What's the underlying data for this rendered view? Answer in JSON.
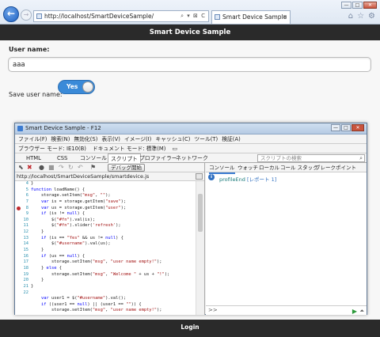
{
  "browser": {
    "url": "http://localhost/SmartDeviceSample/",
    "tab_title": "Smart Device Sample",
    "window_controls": [
      "—",
      "□",
      "✕"
    ],
    "address_tools": "⌕ ▾ ⊠ C"
  },
  "app": {
    "header_title": "Smart Device Sample",
    "username_label": "User name:",
    "username_value": "aaa",
    "save_label": "Save user name:",
    "switch_value": "Yes",
    "footer_button": "Login"
  },
  "devtools": {
    "title": "Smart Device Sample - F12",
    "menu": [
      "ファイル(F)",
      "検索(N)",
      "無効化(S)",
      "表示(V)",
      "イメージ(I)",
      "キャッシュ(C)",
      "ツール(T)",
      "検証(A)"
    ],
    "browser_mode": "ブラウザー モード: IE10(B)",
    "document_mode": "ドキュメント モード: 標準(M)",
    "tabs": [
      "HTML",
      "CSS",
      "コンソール",
      "スクリプト",
      "プロファイラー",
      "ネットワーク"
    ],
    "active_tab": "スクリプト",
    "search_placeholder": "スクリプトの検索",
    "debug_button": "デバッグ開始",
    "file_path": "http://localhost/SmartDeviceSample/smartdevice.js",
    "right_tabs": [
      "コンソール",
      "ウォッチ",
      "ローカル",
      "コール スタック",
      "ブレークポイント"
    ],
    "console_message": "profileEnd",
    "console_report": "[レポート 1]",
    "console_prompt": ">>",
    "code_lines": [
      {
        "n": "4",
        "t": "}"
      },
      {
        "n": "5",
        "t": "function loadName() {"
      },
      {
        "n": "6",
        "t": "    storage.setItem(\"msg\", \"\");"
      },
      {
        "n": "7",
        "t": "    var is = storage.getItem(\"save\");"
      },
      {
        "n": "8",
        "t": "    var us = storage.getItem(\"user\");"
      },
      {
        "n": "9",
        "t": "    if (is != null) {"
      },
      {
        "n": "10",
        "t": "        $(\"#fn\").val(is);"
      },
      {
        "n": "11",
        "t": "        $(\"#fn\").slider('refresh');"
      },
      {
        "n": "12",
        "t": "    }"
      },
      {
        "n": "13",
        "t": "    if (is == \"Yes\" && us != null) {"
      },
      {
        "n": "14",
        "t": "        $(\"#username\").val(us);"
      },
      {
        "n": "15",
        "t": "    }"
      },
      {
        "n": "16",
        "t": "    if (us == null) {"
      },
      {
        "n": "17",
        "t": "        storage.setItem(\"msg\", \"user name empty!\");"
      },
      {
        "n": "18",
        "t": "    } else {"
      },
      {
        "n": "19",
        "t": "        storage.setItem(\"msg\", \"Welcome \" + us + \"!\");"
      },
      {
        "n": "20",
        "t": "    }"
      },
      {
        "n": "21",
        "t": "}"
      },
      {
        "n": "22",
        "t": ""
      },
      {
        "n": "",
        "t": "    var user1 = $(\"#username\").val();"
      },
      {
        "n": "",
        "t": "    if ((user1 == null) || (user1 == \"\")) {"
      },
      {
        "n": "",
        "t": "        storage.setItem(\"msg\", \"user name empty!\");"
      }
    ],
    "breakpoint_line": "8"
  },
  "colors": {
    "header_bg": "#2a2a2a",
    "switch_on": "#3a8ad8",
    "breakpoint": "#c0282d",
    "keyword": "#0000ff",
    "string": "#a31515"
  },
  "icons": {
    "back": "back-arrow-icon",
    "forward": "forward-arrow-icon",
    "home": "home-icon",
    "favorites": "star-icon",
    "settings": "gear-icon",
    "info": "info-icon",
    "run": "run-icon"
  }
}
